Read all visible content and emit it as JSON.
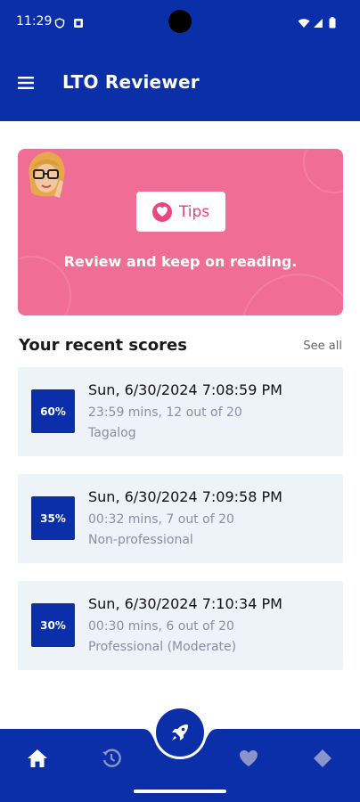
{
  "status_bar": {
    "time": "11:29",
    "icons": [
      "shield-icon",
      "app-notification-icon",
      "wifi-icon",
      "signal-icon",
      "battery-icon"
    ]
  },
  "app_bar": {
    "title": "LTO Reviewer",
    "menu_icon": "hamburger-menu-icon"
  },
  "tips_card": {
    "button_label": "Tips",
    "message": "Review and keep on reading.",
    "background_color": "#f06e96"
  },
  "recent_scores": {
    "title": "Your recent scores",
    "see_all_label": "See all",
    "items": [
      {
        "percent": "60%",
        "date": "Sun, 6/30/2024 7:08:59 PM",
        "meta": "23:59 mins, 12 out of 20",
        "category": "Tagalog"
      },
      {
        "percent": "35%",
        "date": "Sun, 6/30/2024 7:09:58 PM",
        "meta": "00:32 mins, 7 out of 20",
        "category": "Non-professional"
      },
      {
        "percent": "30%",
        "date": "Sun, 6/30/2024 7:10:34 PM",
        "meta": "00:30 mins, 6 out of 20",
        "category": "Professional (Moderate)"
      }
    ]
  },
  "bottom_nav": {
    "items": [
      "home-icon",
      "history-icon",
      "rocket-icon",
      "heart-icon",
      "diamond-icon"
    ],
    "active": "home-icon"
  },
  "colors": {
    "primary": "#0a2fa8",
    "card_background": "#eef2f9",
    "accent_pink": "#e8427a"
  }
}
